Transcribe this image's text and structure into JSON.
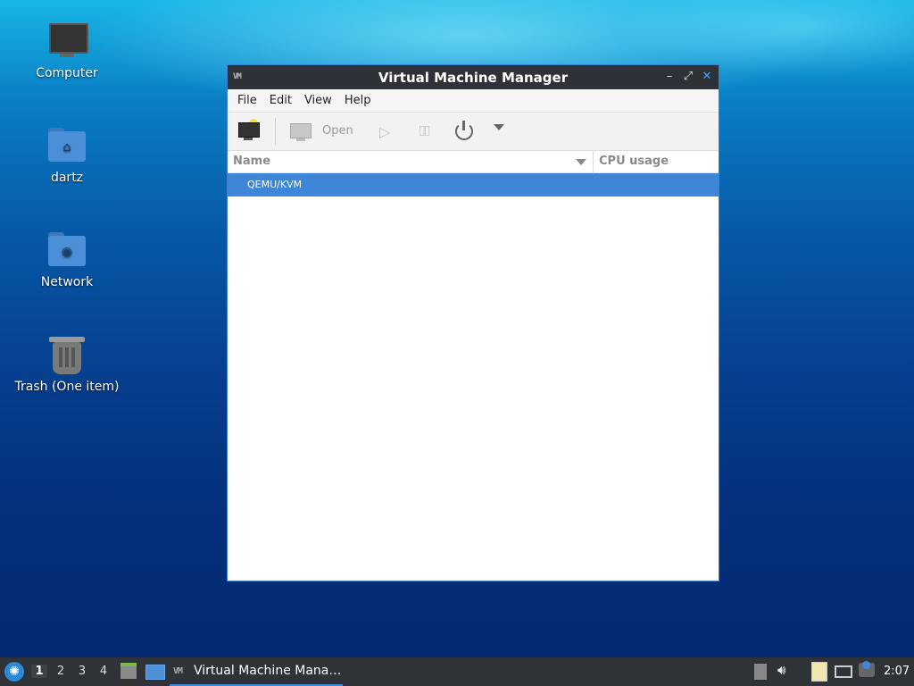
{
  "desktop": {
    "icons": [
      {
        "label": "Computer",
        "icon": "computer-icon"
      },
      {
        "label": "dartz",
        "icon": "home-folder-icon"
      },
      {
        "label": "Network",
        "icon": "network-folder-icon"
      },
      {
        "label": "Trash (One item)",
        "icon": "trash-icon"
      }
    ]
  },
  "window": {
    "title": "Virtual Machine Manager",
    "menu": [
      "File",
      "Edit",
      "View",
      "Help"
    ],
    "toolbar": {
      "new_vm_icon": "new-vm-icon",
      "open_label": "Open",
      "run_icon": "play-icon",
      "pause_icon": "pause-icon",
      "shutdown_icon": "power-icon",
      "more_icon": "dropdown-arrow-icon"
    },
    "columns": {
      "name": "Name",
      "cpu": "CPU usage"
    },
    "rows": [
      {
        "label": "QEMU/KVM",
        "selected": true
      }
    ]
  },
  "taskbar": {
    "workspaces": [
      "1",
      "2",
      "3",
      "4"
    ],
    "active_workspace": "1",
    "task_label": "Virtual Machine Mana…",
    "clock": "2:07"
  },
  "colors": {
    "accent": "#3d86d8",
    "titlebar": "#2e3238",
    "taskbar": "#2f3236"
  }
}
